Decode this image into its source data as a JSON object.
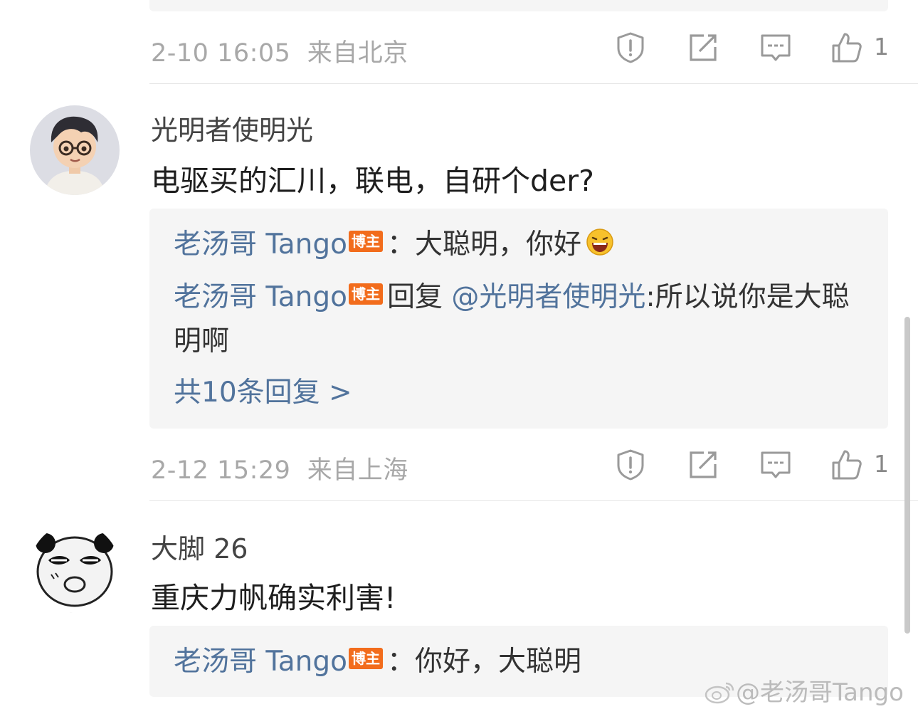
{
  "comments": [
    {
      "meta": {
        "date": "2-10 16:05",
        "location": "来自北京",
        "likes": "1"
      }
    },
    {
      "username": "光明者使明光",
      "text": "电驱买的汇川，联电，自研个der?",
      "replies": [
        {
          "author": "老汤哥 Tango",
          "badge": "博主",
          "sep": "：",
          "text": "大聪明，你好"
        },
        {
          "author": "老汤哥 Tango",
          "badge": "博主",
          "prefix": "回复",
          "mention": "@光明者使明光",
          "text": ":所以说你是大聪明啊"
        }
      ],
      "more_replies": "共10条回复 >",
      "meta": {
        "date": "2-12 15:29",
        "location": "来自上海",
        "likes": "1"
      }
    },
    {
      "username": "大脚 26",
      "text": "重庆力帆确实利害!",
      "replies": [
        {
          "author": "老汤哥 Tango",
          "badge": "博主",
          "sep": "：",
          "text": "你好，大聪明"
        }
      ]
    }
  ],
  "watermark": "@老汤哥Tango",
  "colors": {
    "link": "#51739c",
    "badge": "#f26c1c",
    "meta": "#a8a8a8"
  },
  "icons": [
    "report-icon",
    "repost-icon",
    "comment-icon",
    "like-icon",
    "laugh-emoji-icon",
    "weibo-logo-icon"
  ]
}
